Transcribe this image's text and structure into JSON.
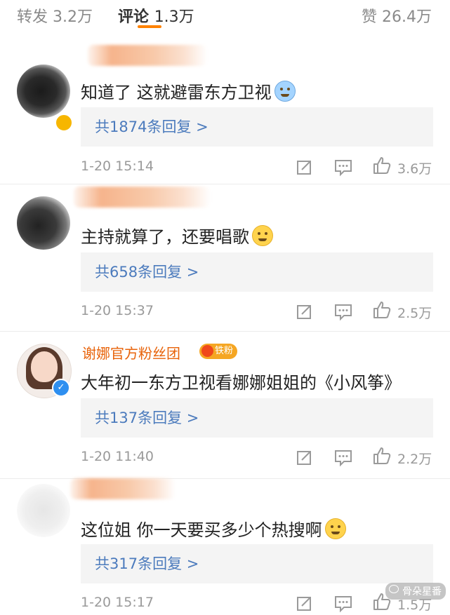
{
  "tabs": {
    "repost": {
      "label": "转发",
      "count": "3.2万"
    },
    "comment": {
      "label": "评论",
      "count": "1.3万"
    },
    "like": {
      "label": "赞",
      "count": "26.4万"
    }
  },
  "comments": [
    {
      "username": "",
      "text": "知道了 这就避雷东方卫视",
      "emoji": "crying-face-emoji",
      "replies": "共1874条回复 >",
      "time": "1-20 15:14",
      "likes": "3.6万"
    },
    {
      "username": "",
      "text": "主持就算了，还要唱歌",
      "emoji": "covering-mouth-emoji",
      "replies": "共658条回复 >",
      "time": "1-20 15:37",
      "likes": "2.5万"
    },
    {
      "username": "谢娜官方粉丝团",
      "badge": "铁粉",
      "text": "大年初一东方卫视看娜娜姐姐的《小风筝》",
      "replies": "共137条回复 >",
      "time": "1-20 11:40",
      "likes": "2.2万"
    },
    {
      "username": "",
      "text": "这位姐 你一天要买多少个热搜啊",
      "emoji": "sweat-smile-emoji",
      "replies": "共317条回复 >",
      "time": "1-20 15:17",
      "likes": "1.5万"
    }
  ],
  "watermark": "骨朵星番",
  "colors": {
    "link": "#4c7bbd",
    "username": "#e8630a",
    "accent": "#ff8200",
    "badge": "#f5a623"
  }
}
